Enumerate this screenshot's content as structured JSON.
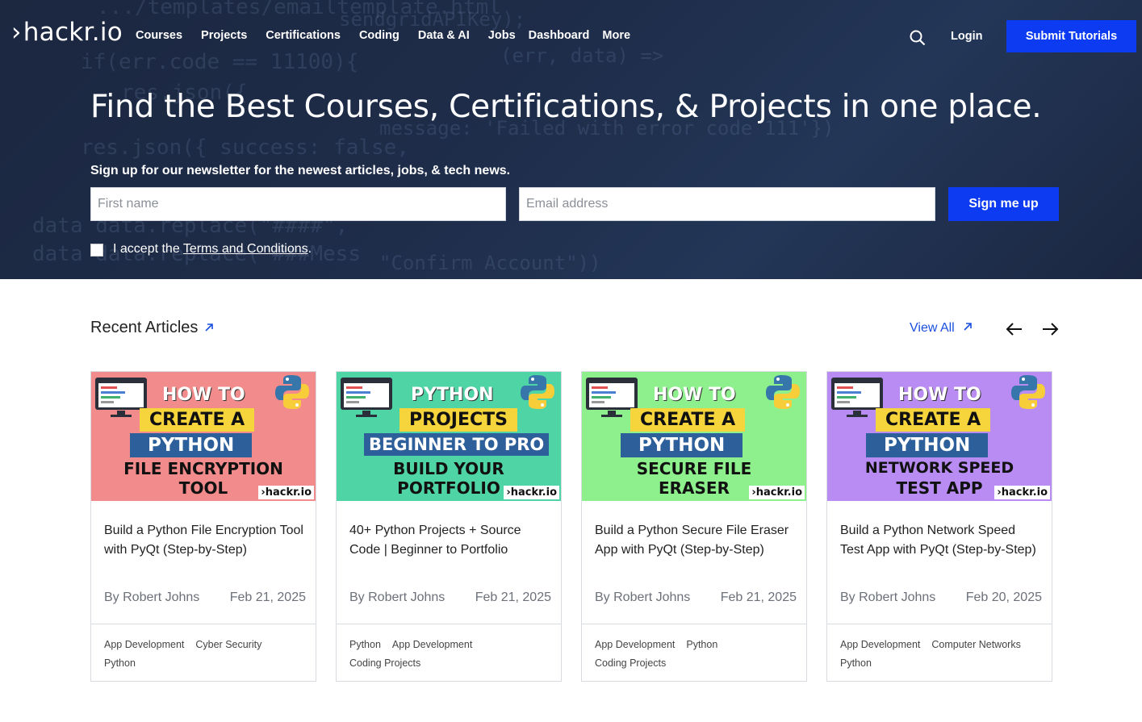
{
  "nav": {
    "logo": "hackr.io",
    "links": [
      "Courses",
      "Projects",
      "Certifications",
      "Coding",
      "Data & AI",
      "Jobs",
      "Dashboard",
      "More"
    ],
    "login": "Login",
    "submit": "Submit Tutorials"
  },
  "hero": {
    "headline": "Find the Best Courses, Certifications, & Projects in one place.",
    "subline": "Sign up for our newsletter for the newest articles, jobs, & tech news.",
    "first_name_placeholder": "First name",
    "email_placeholder": "Email address",
    "signup_button": "Sign me up",
    "terms_prefix": "I accept the ",
    "terms_link": "Terms and Conditions",
    "terms_suffix": "."
  },
  "articles": {
    "title": "Recent Articles",
    "view_all": "View All",
    "cards": [
      {
        "thumb": {
          "bg": "#f28b8b",
          "l1": "HOW TO",
          "l2": "CREATE A",
          "l3": "PYTHON",
          "l4": "FILE ENCRYPTION",
          "l5": "TOOL",
          "logo": "hackr.io"
        },
        "title": "Build a Python File Encryption Tool with PyQt (Step-by-Step)",
        "author": "By Robert Johns",
        "date": "Feb 21, 2025",
        "tags": [
          "App Development",
          "Cyber Security",
          "Python"
        ]
      },
      {
        "thumb": {
          "bg": "#4fd4a6",
          "l1": "PYTHON",
          "l2": "PROJECTS",
          "l3": "BEGINNER TO PRO",
          "l4": "BUILD YOUR",
          "l5": "PORTFOLIO",
          "logo": "hackr.io"
        },
        "title": "40+ Python Projects + Source Code | Beginner to Portfolio",
        "author": "By Robert Johns",
        "date": "Feb 21, 2025",
        "tags": [
          "Python",
          "App Development",
          "Coding Projects"
        ]
      },
      {
        "thumb": {
          "bg": "#8ef08c",
          "l1": "HOW TO",
          "l2": "CREATE A",
          "l3": "PYTHON",
          "l4": "SECURE FILE",
          "l5": "ERASER",
          "logo": "hackr.io"
        },
        "title": "Build a Python Secure File Eraser App with PyQt (Step-by-Step)",
        "author": "By Robert Johns",
        "date": "Feb 21, 2025",
        "tags": [
          "App Development",
          "Python",
          "Coding Projects"
        ]
      },
      {
        "thumb": {
          "bg": "#b88cf2",
          "l1": "HOW TO",
          "l2": "CREATE A",
          "l3": "PYTHON",
          "l4": "NETWORK SPEED",
          "l5": "TEST APP",
          "logo": "hackr.io"
        },
        "title": "Build a Python Network Speed Test App with PyQt (Step-by-Step)",
        "author": "By Robert Johns",
        "date": "Feb 20, 2025",
        "tags": [
          "App Development",
          "Computer Networks",
          "Python"
        ]
      }
    ]
  }
}
